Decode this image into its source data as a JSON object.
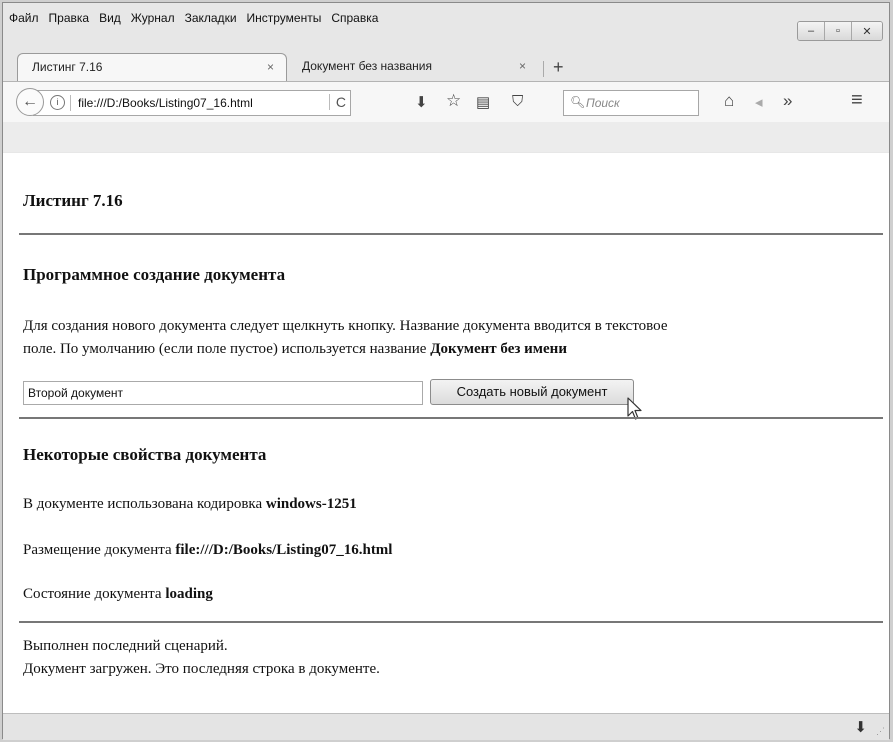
{
  "menu": [
    "Файл",
    "Правка",
    "Вид",
    "Журнал",
    "Закладки",
    "Инструменты",
    "Справка"
  ],
  "window_controls": {
    "minimize": "‒",
    "maximize": "▫",
    "close": "✕"
  },
  "tabs": [
    {
      "label": "Листинг 7.16",
      "close": "×"
    },
    {
      "label": "Документ без названия",
      "close": "×"
    }
  ],
  "new_tab": "+",
  "navbar": {
    "back": "←",
    "info": "i",
    "url": "file:///D:/Books/Listing07_16.html",
    "reload": "C",
    "download": "⬇",
    "star": "☆",
    "reading_list": "▤",
    "pocket": "⛉",
    "search_icon": "🔍︎",
    "search_placeholder": "Поиск",
    "home": "⌂",
    "share": "◂",
    "overflow": "»",
    "menu": "≡"
  },
  "page": {
    "heading": "Листинг 7.16",
    "section1_title": "Программное создание документа",
    "section1_text_1": "Для создания нового документа следует щелкнуть кнопку. Название документа вводится в текстовое",
    "section1_text_2": "поле. По умолчанию (если поле пустое) используется название",
    "section1_text_bold": "Документ без имени",
    "input_value": "Второй документ",
    "button_label": "Создать новый документ",
    "section2_title": "Некоторые свойства документа",
    "charset_label": "В документе использована кодировка",
    "charset_value": "windows-1251",
    "location_label": "Размещение документа",
    "location_value": "file:///D:/Books/Listing07_16.html",
    "state_label": "Состояние документа",
    "state_value": "loading",
    "footer_line1": "Выполнен последний сценарий.",
    "footer_line2": "Документ загружен. Это последняя строка в документе."
  },
  "statusbar": {
    "download": "⬇",
    "grip": "⋰"
  }
}
